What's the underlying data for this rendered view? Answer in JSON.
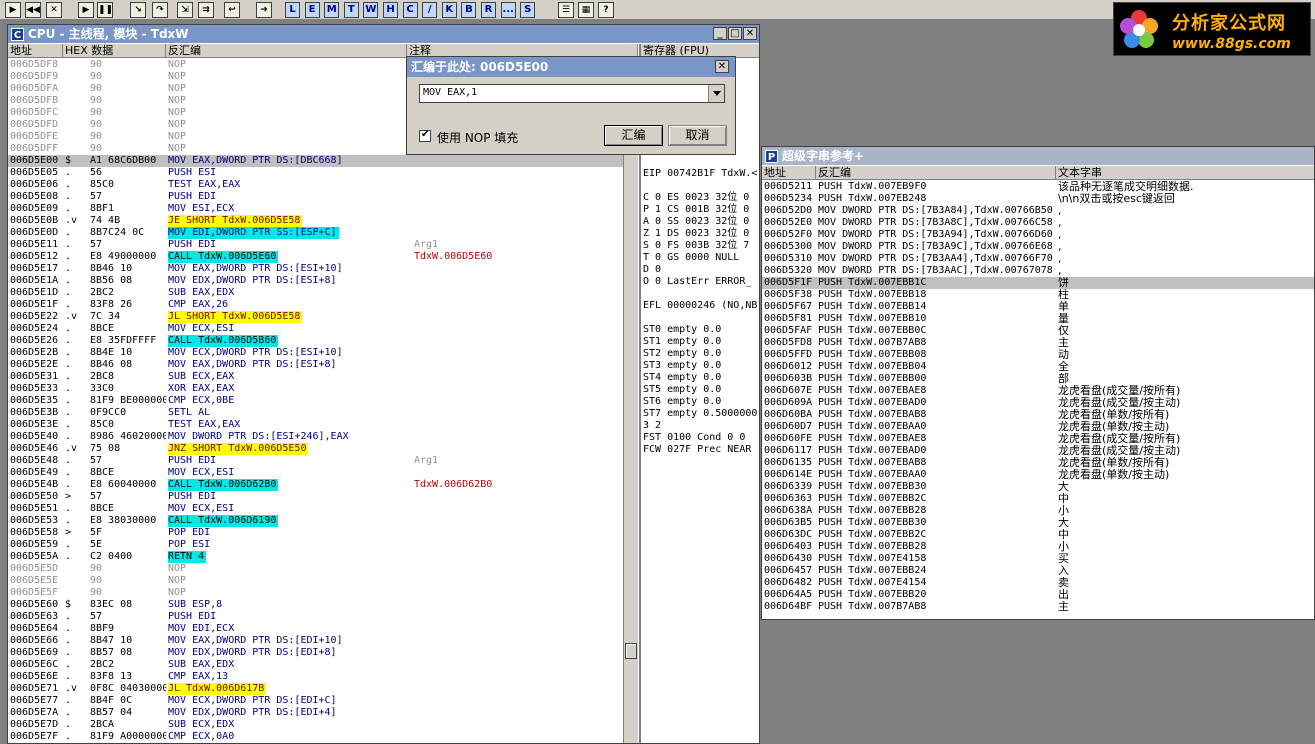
{
  "toolbar": {
    "icon_buttons": [
      "open-icon",
      "rewind-icon",
      "close-icon",
      "run-icon",
      "pause-icon",
      "step-into-icon",
      "step-over-icon",
      "trace-into-icon",
      "trace-over-icon",
      "execute-till-return-icon",
      "goto-icon"
    ],
    "letter_buttons": [
      "L",
      "E",
      "M",
      "T",
      "W",
      "H",
      "C",
      "/",
      "K",
      "B",
      "R",
      "...",
      "S"
    ],
    "right_icons": [
      "list-icon",
      "grid-icon",
      "help-icon"
    ]
  },
  "logo": {
    "line1": "分析家公式网",
    "line2": "www.88gs.com"
  },
  "cpu_window": {
    "title": "CPU - 主线程, 模块 - TdxW",
    "headers": {
      "address": "地址",
      "hex": "HEX 数据",
      "disasm": "反汇编",
      "comment": "注释"
    },
    "rows": [
      {
        "addr": "006D5DF8",
        "m": "",
        "hex": "90",
        "asm": "NOP",
        "c": "",
        "hl": "",
        "gray": true
      },
      {
        "addr": "006D5DF9",
        "m": "",
        "hex": "90",
        "asm": "NOP",
        "c": "",
        "hl": "",
        "gray": true
      },
      {
        "addr": "006D5DFA",
        "m": "",
        "hex": "90",
        "asm": "NOP",
        "c": "",
        "hl": "",
        "gray": true
      },
      {
        "addr": "006D5DFB",
        "m": "",
        "hex": "90",
        "asm": "NOP",
        "c": "",
        "hl": "",
        "gray": true
      },
      {
        "addr": "006D5DFC",
        "m": "",
        "hex": "90",
        "asm": "NOP",
        "c": "",
        "hl": "",
        "gray": true
      },
      {
        "addr": "006D5DFD",
        "m": "",
        "hex": "90",
        "asm": "NOP",
        "c": "",
        "hl": "",
        "gray": true
      },
      {
        "addr": "006D5DFE",
        "m": "",
        "hex": "90",
        "asm": "NOP",
        "c": "",
        "hl": "",
        "gray": true
      },
      {
        "addr": "006D5DFF",
        "m": "",
        "hex": "90",
        "asm": "NOP",
        "c": "",
        "hl": "",
        "gray": true
      },
      {
        "addr": "006D5E00",
        "m": "$",
        "hex": "A1 68C6DB00",
        "asm": "MOV EAX,DWORD PTR DS:[DBC668]",
        "c": "",
        "hl": "sel",
        "gray": false
      },
      {
        "addr": "006D5E05",
        "m": ".",
        "hex": "56",
        "asm": "PUSH ESI",
        "c": "",
        "hl": "",
        "gray": false
      },
      {
        "addr": "006D5E06",
        "m": ".",
        "hex": "85C0",
        "asm": "TEST EAX,EAX",
        "c": "",
        "hl": "",
        "gray": false
      },
      {
        "addr": "006D5E08",
        "m": ".",
        "hex": "57",
        "asm": "PUSH EDI",
        "c": "",
        "hl": "",
        "gray": false
      },
      {
        "addr": "006D5E09",
        "m": ".",
        "hex": "8BF1",
        "asm": "MOV ESI,ECX",
        "c": "",
        "hl": "",
        "gray": false
      },
      {
        "addr": "006D5E0B",
        "m": ".v",
        "hex": "74 4B",
        "asm": "JE SHORT TdxW.006D5E58",
        "c": "",
        "hl": "y",
        "gray": false
      },
      {
        "addr": "006D5E0D",
        "m": ".",
        "hex": "8B7C24 0C",
        "asm": "MOV EDI,DWORD PTR SS:[ESP+C]",
        "c": "",
        "hl": "c2",
        "gray": false
      },
      {
        "addr": "006D5E11",
        "m": ".",
        "hex": "57",
        "asm": "PUSH EDI",
        "c": "Arg1",
        "hl": "",
        "gray": false
      },
      {
        "addr": "006D5E12",
        "m": ".",
        "hex": "E8 49000000",
        "asm": "CALL TdxW.006D5E60",
        "c": "TdxW.006D5E60",
        "hl": "c",
        "gray": false
      },
      {
        "addr": "006D5E17",
        "m": ".",
        "hex": "8B46 10",
        "asm": "MOV EAX,DWORD PTR DS:[ESI+10]",
        "c": "",
        "hl": "",
        "gray": false
      },
      {
        "addr": "006D5E1A",
        "m": ".",
        "hex": "8B56 08",
        "asm": "MOV EDX,DWORD PTR DS:[ESI+8]",
        "c": "",
        "hl": "",
        "gray": false
      },
      {
        "addr": "006D5E1D",
        "m": ".",
        "hex": "2BC2",
        "asm": "SUB EAX,EDX",
        "c": "",
        "hl": "",
        "gray": false
      },
      {
        "addr": "006D5E1F",
        "m": ".",
        "hex": "83F8 26",
        "asm": "CMP EAX,26",
        "c": "",
        "hl": "",
        "gray": false
      },
      {
        "addr": "006D5E22",
        "m": ".v",
        "hex": "7C 34",
        "asm": "JL SHORT TdxW.006D5E58",
        "c": "",
        "hl": "y",
        "gray": false
      },
      {
        "addr": "006D5E24",
        "m": ".",
        "hex": "8BCE",
        "asm": "MOV ECX,ESI",
        "c": "",
        "hl": "",
        "gray": false
      },
      {
        "addr": "006D5E26",
        "m": ".",
        "hex": "E8 35FDFFFF",
        "asm": "CALL TdxW.006D5B60",
        "c": "",
        "hl": "c",
        "gray": false
      },
      {
        "addr": "006D5E2B",
        "m": ".",
        "hex": "8B4E 10",
        "asm": "MOV ECX,DWORD PTR DS:[ESI+10]",
        "c": "",
        "hl": "",
        "gray": false
      },
      {
        "addr": "006D5E2E",
        "m": ".",
        "hex": "8B46 08",
        "asm": "MOV EAX,DWORD PTR DS:[ESI+8]",
        "c": "",
        "hl": "",
        "gray": false
      },
      {
        "addr": "006D5E31",
        "m": ".",
        "hex": "2BC8",
        "asm": "SUB ECX,EAX",
        "c": "",
        "hl": "",
        "gray": false
      },
      {
        "addr": "006D5E33",
        "m": ".",
        "hex": "33C0",
        "asm": "XOR EAX,EAX",
        "c": "",
        "hl": "",
        "gray": false
      },
      {
        "addr": "006D5E35",
        "m": ".",
        "hex": "81F9 BE000000",
        "asm": "CMP ECX,0BE",
        "c": "",
        "hl": "",
        "gray": false
      },
      {
        "addr": "006D5E3B",
        "m": ".",
        "hex": "0F9CC0",
        "asm": "SETL AL",
        "c": "",
        "hl": "",
        "gray": false
      },
      {
        "addr": "006D5E3E",
        "m": ".",
        "hex": "85C0",
        "asm": "TEST EAX,EAX",
        "c": "",
        "hl": "",
        "gray": false
      },
      {
        "addr": "006D5E40",
        "m": ".",
        "hex": "8986 46020000",
        "asm": "MOV DWORD PTR DS:[ESI+246],EAX",
        "c": "",
        "hl": "",
        "gray": false
      },
      {
        "addr": "006D5E46",
        "m": ".v",
        "hex": "75 08",
        "asm": "JNZ SHORT TdxW.006D5E50",
        "c": "",
        "hl": "y",
        "gray": false
      },
      {
        "addr": "006D5E48",
        "m": ".",
        "hex": "57",
        "asm": "PUSH EDI",
        "c": "Arg1",
        "hl": "",
        "gray": false
      },
      {
        "addr": "006D5E49",
        "m": ".",
        "hex": "8BCE",
        "asm": "MOV ECX,ESI",
        "c": "",
        "hl": "",
        "gray": false
      },
      {
        "addr": "006D5E4B",
        "m": ".",
        "hex": "E8 60040000",
        "asm": "CALL TdxW.006D62B0",
        "c": "TdxW.006D62B0",
        "hl": "c",
        "gray": false
      },
      {
        "addr": "006D5E50",
        "m": ">",
        "hex": "57",
        "asm": "PUSH EDI",
        "c": "",
        "hl": "",
        "gray": false
      },
      {
        "addr": "006D5E51",
        "m": ".",
        "hex": "8BCE",
        "asm": "MOV ECX,ESI",
        "c": "",
        "hl": "",
        "gray": false
      },
      {
        "addr": "006D5E53",
        "m": ".",
        "hex": "E8 38030000",
        "asm": "CALL TdxW.006D6190",
        "c": "",
        "hl": "c",
        "gray": false
      },
      {
        "addr": "006D5E58",
        "m": ">",
        "hex": "5F",
        "asm": "POP EDI",
        "c": "",
        "hl": "",
        "gray": false
      },
      {
        "addr": "006D5E59",
        "m": ".",
        "hex": "5E",
        "asm": "POP ESI",
        "c": "",
        "hl": "",
        "gray": false
      },
      {
        "addr": "006D5E5A",
        "m": ".",
        "hex": "C2 0400",
        "asm": "RETN 4",
        "c": "",
        "hl": "r",
        "gray": false
      },
      {
        "addr": "006D5E5D",
        "m": "",
        "hex": "90",
        "asm": "NOP",
        "c": "",
        "hl": "",
        "gray": true
      },
      {
        "addr": "006D5E5E",
        "m": "",
        "hex": "90",
        "asm": "NOP",
        "c": "",
        "hl": "",
        "gray": true
      },
      {
        "addr": "006D5E5F",
        "m": "",
        "hex": "90",
        "asm": "NOP",
        "c": "",
        "hl": "",
        "gray": true
      },
      {
        "addr": "006D5E60",
        "m": "$",
        "hex": "83EC 08",
        "asm": "SUB ESP,8",
        "c": "",
        "hl": "",
        "gray": false
      },
      {
        "addr": "006D5E63",
        "m": ".",
        "hex": "57",
        "asm": "PUSH EDI",
        "c": "",
        "hl": "",
        "gray": false
      },
      {
        "addr": "006D5E64",
        "m": ".",
        "hex": "8BF9",
        "asm": "MOV EDI,ECX",
        "c": "",
        "hl": "",
        "gray": false
      },
      {
        "addr": "006D5E66",
        "m": ".",
        "hex": "8B47 10",
        "asm": "MOV EAX,DWORD PTR DS:[EDI+10]",
        "c": "",
        "hl": "",
        "gray": false
      },
      {
        "addr": "006D5E69",
        "m": ".",
        "hex": "8B57 08",
        "asm": "MOV EDX,DWORD PTR DS:[EDI+8]",
        "c": "",
        "hl": "",
        "gray": false
      },
      {
        "addr": "006D5E6C",
        "m": ".",
        "hex": "2BC2",
        "asm": "SUB EAX,EDX",
        "c": "",
        "hl": "",
        "gray": false
      },
      {
        "addr": "006D5E6E",
        "m": ".",
        "hex": "83F8 13",
        "asm": "CMP EAX,13",
        "c": "",
        "hl": "",
        "gray": false
      },
      {
        "addr": "006D5E71",
        "m": ".v",
        "hex": "0F8C 04030000",
        "asm": "JL TdxW.006D617B",
        "c": "",
        "hl": "y",
        "gray": false
      },
      {
        "addr": "006D5E77",
        "m": ".",
        "hex": "8B4F 0C",
        "asm": "MOV ECX,DWORD PTR DS:[EDI+C]",
        "c": "",
        "hl": "",
        "gray": false
      },
      {
        "addr": "006D5E7A",
        "m": ".",
        "hex": "8B57 04",
        "asm": "MOV EDX,DWORD PTR DS:[EDI+4]",
        "c": "",
        "hl": "",
        "gray": false
      },
      {
        "addr": "006D5E7D",
        "m": ".",
        "hex": "2BCA",
        "asm": "SUB ECX,EDX",
        "c": "",
        "hl": "",
        "gray": false
      },
      {
        "addr": "006D5E7F",
        "m": ".",
        "hex": "81F9 A0000000",
        "asm": "CMP ECX,0A0",
        "c": "",
        "hl": "",
        "gray": false
      }
    ]
  },
  "registers": {
    "header": "寄存器 (FPU)",
    "lines": [
      {
        "t": "nel",
        "c": "#000"
      },
      {
        "t": "",
        "c": "#000"
      },
      {
        "t": "W.<",
        "c": "#000"
      },
      {
        "t": "",
        "c": "#000"
      },
      {
        "t": "",
        "c": "#000"
      },
      {
        "t": "",
        "c": "#000"
      },
      {
        "t": "",
        "c": "#000"
      },
      {
        "t": "",
        "c": "#000"
      },
      {
        "t": "",
        "c": "#000"
      },
      {
        "t": "EIP 00742B1F TdxW.<",
        "c": "#000"
      },
      {
        "t": "",
        "c": "#000"
      },
      {
        "t": "C 0  ES 0023 32位 0",
        "c": "#000"
      },
      {
        "t": "P 1  CS 001B 32位 0",
        "c": "#000"
      },
      {
        "t": "A 0  SS 0023 32位 0",
        "c": "#000"
      },
      {
        "t": "Z 1  DS 0023 32位 0",
        "c": "#000"
      },
      {
        "t": "S 0  FS 003B 32位 7",
        "c": "#000"
      },
      {
        "t": "T 0  GS 0000 NULL",
        "c": "#000"
      },
      {
        "t": "D 0",
        "c": "#000"
      },
      {
        "t": "O 0  LastErr ERROR_",
        "c": "#000"
      },
      {
        "t": "",
        "c": "#000"
      },
      {
        "t": "EFL 00000246 (NO,NB",
        "c": "#000"
      },
      {
        "t": "",
        "c": "#000"
      },
      {
        "t": "ST0 empty 0.0",
        "c": "#000"
      },
      {
        "t": "ST1 empty 0.0",
        "c": "#000"
      },
      {
        "t": "ST2 empty 0.0",
        "c": "#000"
      },
      {
        "t": "ST3 empty 0.0",
        "c": "#000"
      },
      {
        "t": "ST4 empty 0.0",
        "c": "#000"
      },
      {
        "t": "ST5 empty 0.0",
        "c": "#000"
      },
      {
        "t": "ST6 empty 0.0",
        "c": "#000"
      },
      {
        "t": "ST7 empty 0.5000000",
        "c": "#000"
      },
      {
        "t": "                3 2",
        "c": "#000"
      },
      {
        "t": "FST 0100  Cond 0 0",
        "c": "#000"
      },
      {
        "t": "FCW 027F  Prec NEAR",
        "c": "#000"
      }
    ]
  },
  "assemble_dialog": {
    "title": "汇编于此处: 006D5E00",
    "input_value": "MOV EAX,1",
    "checkbox_label": "使用 NOP 填充",
    "checkbox_checked": true,
    "assemble_button": "汇编",
    "cancel_button": "取消"
  },
  "string_ref_window": {
    "title": "超级字串参考+",
    "headers": {
      "address": "地址",
      "disasm": "反汇编",
      "text": "文本字串"
    },
    "rows": [
      {
        "addr": "006D5211",
        "asm": "PUSH TdxW.007EB9F0",
        "text": "该品种无逐笔成交明细数据.",
        "sel": false
      },
      {
        "addr": "006D5234",
        "asm": "PUSH TdxW.007EB248",
        "text": "\\n\\n双击或按esc键返回",
        "sel": false
      },
      {
        "addr": "006D52D0",
        "asm": "MOV DWORD PTR DS:[7B3A84],TdxW.00766B50",
        "text": ",",
        "sel": false
      },
      {
        "addr": "006D52E0",
        "asm": "MOV DWORD PTR DS:[7B3A8C],TdxW.00766C58",
        "text": ",",
        "sel": false
      },
      {
        "addr": "006D52F0",
        "asm": "MOV DWORD PTR DS:[7B3A94],TdxW.00766D60",
        "text": ",",
        "sel": false
      },
      {
        "addr": "006D5300",
        "asm": "MOV DWORD PTR DS:[7B3A9C],TdxW.00766E68",
        "text": ",",
        "sel": false
      },
      {
        "addr": "006D5310",
        "asm": "MOV DWORD PTR DS:[7B3AA4],TdxW.00766F70",
        "text": ",",
        "sel": false
      },
      {
        "addr": "006D5320",
        "asm": "MOV DWORD PTR DS:[7B3AAC],TdxW.00767078",
        "text": ",",
        "sel": false
      },
      {
        "addr": "006D5F1F",
        "asm": "PUSH TdxW.007EBB1C",
        "text": "饼",
        "sel": true
      },
      {
        "addr": "006D5F38",
        "asm": "PUSH TdxW.007EBB18",
        "text": "柱",
        "sel": false
      },
      {
        "addr": "006D5F67",
        "asm": "PUSH TdxW.007EBB14",
        "text": "单",
        "sel": false
      },
      {
        "addr": "006D5F81",
        "asm": "PUSH TdxW.007EBB10",
        "text": "量",
        "sel": false
      },
      {
        "addr": "006D5FAF",
        "asm": "PUSH TdxW.007EBB0C",
        "text": "仅",
        "sel": false
      },
      {
        "addr": "006D5FD8",
        "asm": "PUSH TdxW.007B7AB8",
        "text": "主",
        "sel": false
      },
      {
        "addr": "006D5FFD",
        "asm": "PUSH TdxW.007EBB08",
        "text": "动",
        "sel": false
      },
      {
        "addr": "006D6012",
        "asm": "PUSH TdxW.007EBB04",
        "text": "全",
        "sel": false
      },
      {
        "addr": "006D603B",
        "asm": "PUSH TdxW.007EBB00",
        "text": "部",
        "sel": false
      },
      {
        "addr": "006D607E",
        "asm": "PUSH TdxW.007EBAE8",
        "text": "龙虎看盘(成交量/按所有)",
        "sel": false
      },
      {
        "addr": "006D609A",
        "asm": "PUSH TdxW.007EBAD0",
        "text": "龙虎看盘(成交量/按主动)",
        "sel": false
      },
      {
        "addr": "006D60BA",
        "asm": "PUSH TdxW.007EBAB8",
        "text": "龙虎看盘(单数/按所有)",
        "sel": false
      },
      {
        "addr": "006D60D7",
        "asm": "PUSH TdxW.007EBAA0",
        "text": "龙虎看盘(单数/按主动)",
        "sel": false
      },
      {
        "addr": "006D60FE",
        "asm": "PUSH TdxW.007EBAE8",
        "text": "龙虎看盘(成交量/按所有)",
        "sel": false
      },
      {
        "addr": "006D6117",
        "asm": "PUSH TdxW.007EBAD0",
        "text": "龙虎看盘(成交量/按主动)",
        "sel": false
      },
      {
        "addr": "006D6135",
        "asm": "PUSH TdxW.007EBAB8",
        "text": "龙虎看盘(单数/按所有)",
        "sel": false
      },
      {
        "addr": "006D614E",
        "asm": "PUSH TdxW.007EBAA0",
        "text": "龙虎看盘(单数/按主动)",
        "sel": false
      },
      {
        "addr": "006D6339",
        "asm": "PUSH TdxW.007EBB30",
        "text": "大",
        "sel": false
      },
      {
        "addr": "006D6363",
        "asm": "PUSH TdxW.007EBB2C",
        "text": "中",
        "sel": false
      },
      {
        "addr": "006D638A",
        "asm": "PUSH TdxW.007EBB28",
        "text": "小",
        "sel": false
      },
      {
        "addr": "006D63B5",
        "asm": "PUSH TdxW.007EBB30",
        "text": "大",
        "sel": false
      },
      {
        "addr": "006D63DC",
        "asm": "PUSH TdxW.007EBB2C",
        "text": "中",
        "sel": false
      },
      {
        "addr": "006D6403",
        "asm": "PUSH TdxW.007EBB28",
        "text": "小",
        "sel": false
      },
      {
        "addr": "006D6430",
        "asm": "PUSH TdxW.007E4158",
        "text": "买",
        "sel": false
      },
      {
        "addr": "006D6457",
        "asm": "PUSH TdxW.007EBB24",
        "text": "入",
        "sel": false
      },
      {
        "addr": "006D6482",
        "asm": "PUSH TdxW.007E4154",
        "text": "卖",
        "sel": false
      },
      {
        "addr": "006D64A5",
        "asm": "PUSH TdxW.007EBB20",
        "text": "出",
        "sel": false
      },
      {
        "addr": "006D64BF",
        "asm": "PUSH TdxW.007B7AB8",
        "text": "主",
        "sel": false
      }
    ]
  },
  "colors": {
    "yellow": "#ffff00",
    "cyan": "#00e8e8",
    "selection": "#c0c0c0",
    "comment_red": "#c00000",
    "dark_red": "#800000",
    "titlebar": "#7a96c8"
  }
}
